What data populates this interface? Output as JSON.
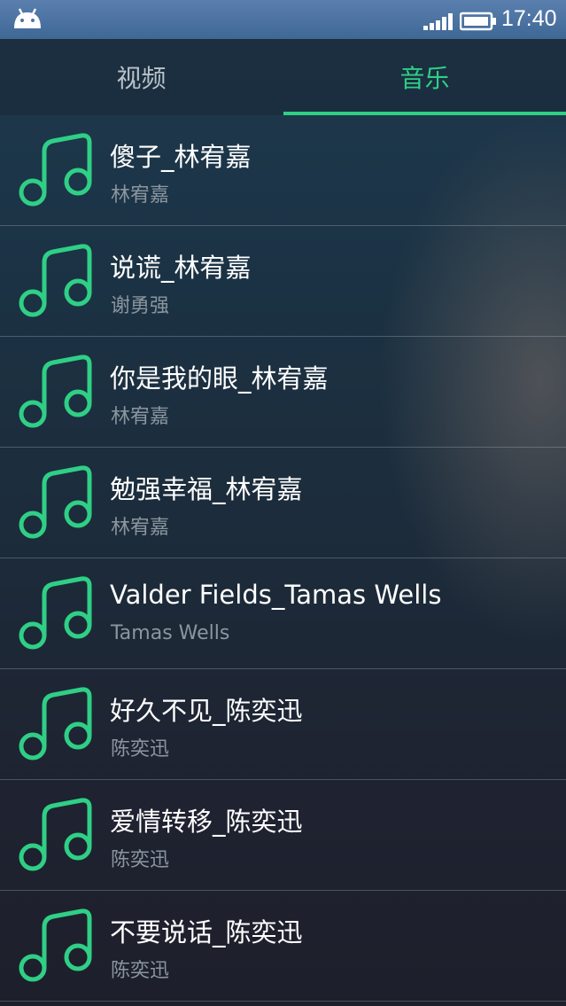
{
  "status_bar": {
    "time": "17:40"
  },
  "tabs": [
    {
      "label": "视频",
      "selected": false
    },
    {
      "label": "音乐",
      "selected": true
    }
  ],
  "accent_color": "#2fcf86",
  "songs": [
    {
      "title": "傻子_林宥嘉",
      "artist": "林宥嘉"
    },
    {
      "title": "说谎_林宥嘉",
      "artist": "谢勇强"
    },
    {
      "title": "你是我的眼_林宥嘉",
      "artist": "林宥嘉"
    },
    {
      "title": "勉强幸福_林宥嘉",
      "artist": "林宥嘉"
    },
    {
      "title": "Valder Fields_Tamas Wells",
      "artist": "Tamas Wells"
    },
    {
      "title": "好久不见_陈奕迅",
      "artist": "陈奕迅"
    },
    {
      "title": "爱情转移_陈奕迅",
      "artist": "陈奕迅"
    },
    {
      "title": "不要说话_陈奕迅",
      "artist": "陈奕迅"
    }
  ]
}
